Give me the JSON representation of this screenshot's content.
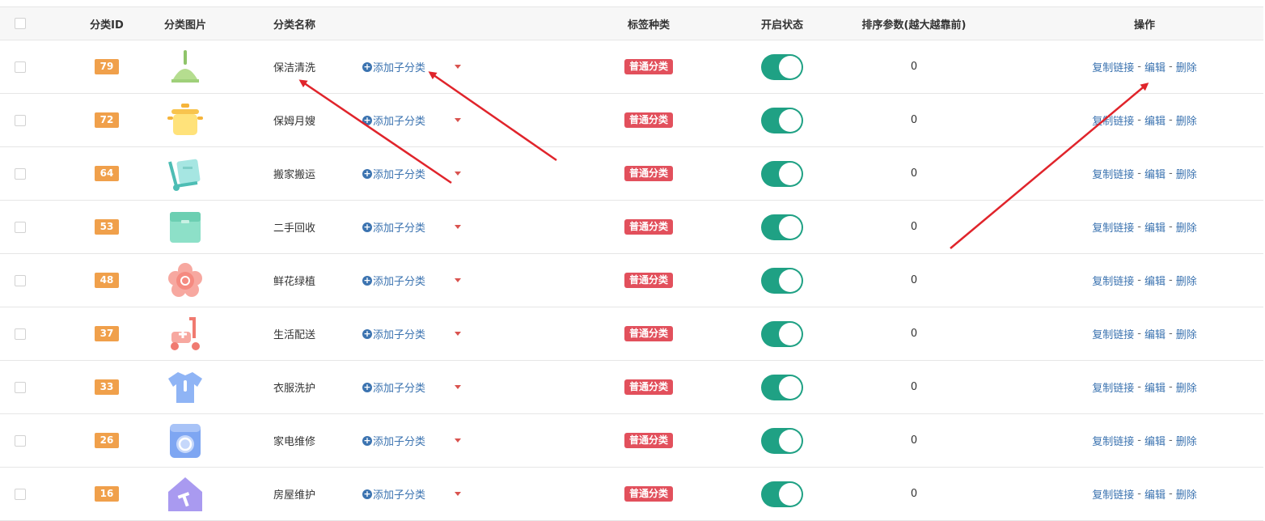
{
  "header": {
    "id": "分类ID",
    "image": "分类图片",
    "name": "分类名称",
    "tag_type": "标签种类",
    "status": "开启状态",
    "sort": "排序参数(越大越靠前)",
    "ops": "操作"
  },
  "rows": [
    {
      "id": "79",
      "name": "保洁清洗",
      "icon": "broom-icon",
      "add": "添加子分类",
      "tag": "普通分类",
      "enabled": true,
      "sort": "0",
      "copy": "复制链接",
      "edit": "编辑",
      "del": "删除"
    },
    {
      "id": "72",
      "name": "保姆月嫂",
      "icon": "pot-icon",
      "add": "添加子分类",
      "tag": "普通分类",
      "enabled": true,
      "sort": "0",
      "copy": "复制链接",
      "edit": "编辑",
      "del": "删除"
    },
    {
      "id": "64",
      "name": "搬家搬运",
      "icon": "hand-truck-icon",
      "add": "添加子分类",
      "tag": "普通分类",
      "enabled": true,
      "sort": "0",
      "copy": "复制链接",
      "edit": "编辑",
      "del": "删除"
    },
    {
      "id": "53",
      "name": "二手回收",
      "icon": "box-icon",
      "add": "添加子分类",
      "tag": "普通分类",
      "enabled": true,
      "sort": "0",
      "copy": "复制链接",
      "edit": "编辑",
      "del": "删除"
    },
    {
      "id": "48",
      "name": "鲜花绿植",
      "icon": "flower-icon",
      "add": "添加子分类",
      "tag": "普通分类",
      "enabled": true,
      "sort": "0",
      "copy": "复制链接",
      "edit": "编辑",
      "del": "删除"
    },
    {
      "id": "37",
      "name": "生活配送",
      "icon": "scooter-icon",
      "add": "添加子分类",
      "tag": "普通分类",
      "enabled": true,
      "sort": "0",
      "copy": "复制链接",
      "edit": "编辑",
      "del": "删除"
    },
    {
      "id": "33",
      "name": "衣服洗护",
      "icon": "shirt-icon",
      "add": "添加子分类",
      "tag": "普通分类",
      "enabled": true,
      "sort": "0",
      "copy": "复制链接",
      "edit": "编辑",
      "del": "删除"
    },
    {
      "id": "26",
      "name": "家电维修",
      "icon": "washing-machine-icon",
      "add": "添加子分类",
      "tag": "普通分类",
      "enabled": true,
      "sort": "0",
      "copy": "复制链接",
      "edit": "编辑",
      "del": "删除"
    },
    {
      "id": "16",
      "name": "房屋维护",
      "icon": "house-hammer-icon",
      "add": "添加子分类",
      "tag": "普通分类",
      "enabled": true,
      "sort": "0",
      "copy": "复制链接",
      "edit": "编辑",
      "del": "删除"
    }
  ],
  "colors": {
    "id_badge": "#f0a04b",
    "tag": "#e2505c",
    "switch_on": "#1fa184",
    "link": "#3b73b0",
    "annotation_arrow": "#e0242b"
  }
}
